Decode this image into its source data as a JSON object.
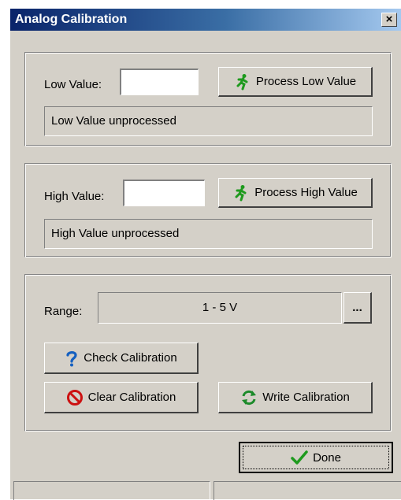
{
  "window": {
    "title": "Analog Calibration",
    "close_label": "×"
  },
  "low": {
    "label": "Low Value:",
    "value": "",
    "button_label": "Process Low Value",
    "status": "Low Value unprocessed"
  },
  "high": {
    "label": "High Value:",
    "value": "",
    "button_label": "Process High Value",
    "status": "High Value unprocessed"
  },
  "range": {
    "label": "Range:",
    "value": "1 - 5 V",
    "browse_label": "..."
  },
  "actions": {
    "check_label": "Check Calibration",
    "clear_label": "Clear Calibration",
    "write_label": "Write Calibration",
    "done_label": "Done"
  },
  "icons": {
    "process": "running-person-icon",
    "check": "question-icon",
    "clear": "prohibited-icon",
    "write": "refresh-icon",
    "done": "checkmark-icon"
  },
  "colors": {
    "dialog_bg": "#d4d0c8",
    "title_start": "#0a246a",
    "title_end": "#a6caf0",
    "person": "#1e9a1e",
    "question": "#1560c0",
    "prohibit": "#cc1111",
    "refresh": "#1c8a2a",
    "check": "#1e9a1e"
  }
}
